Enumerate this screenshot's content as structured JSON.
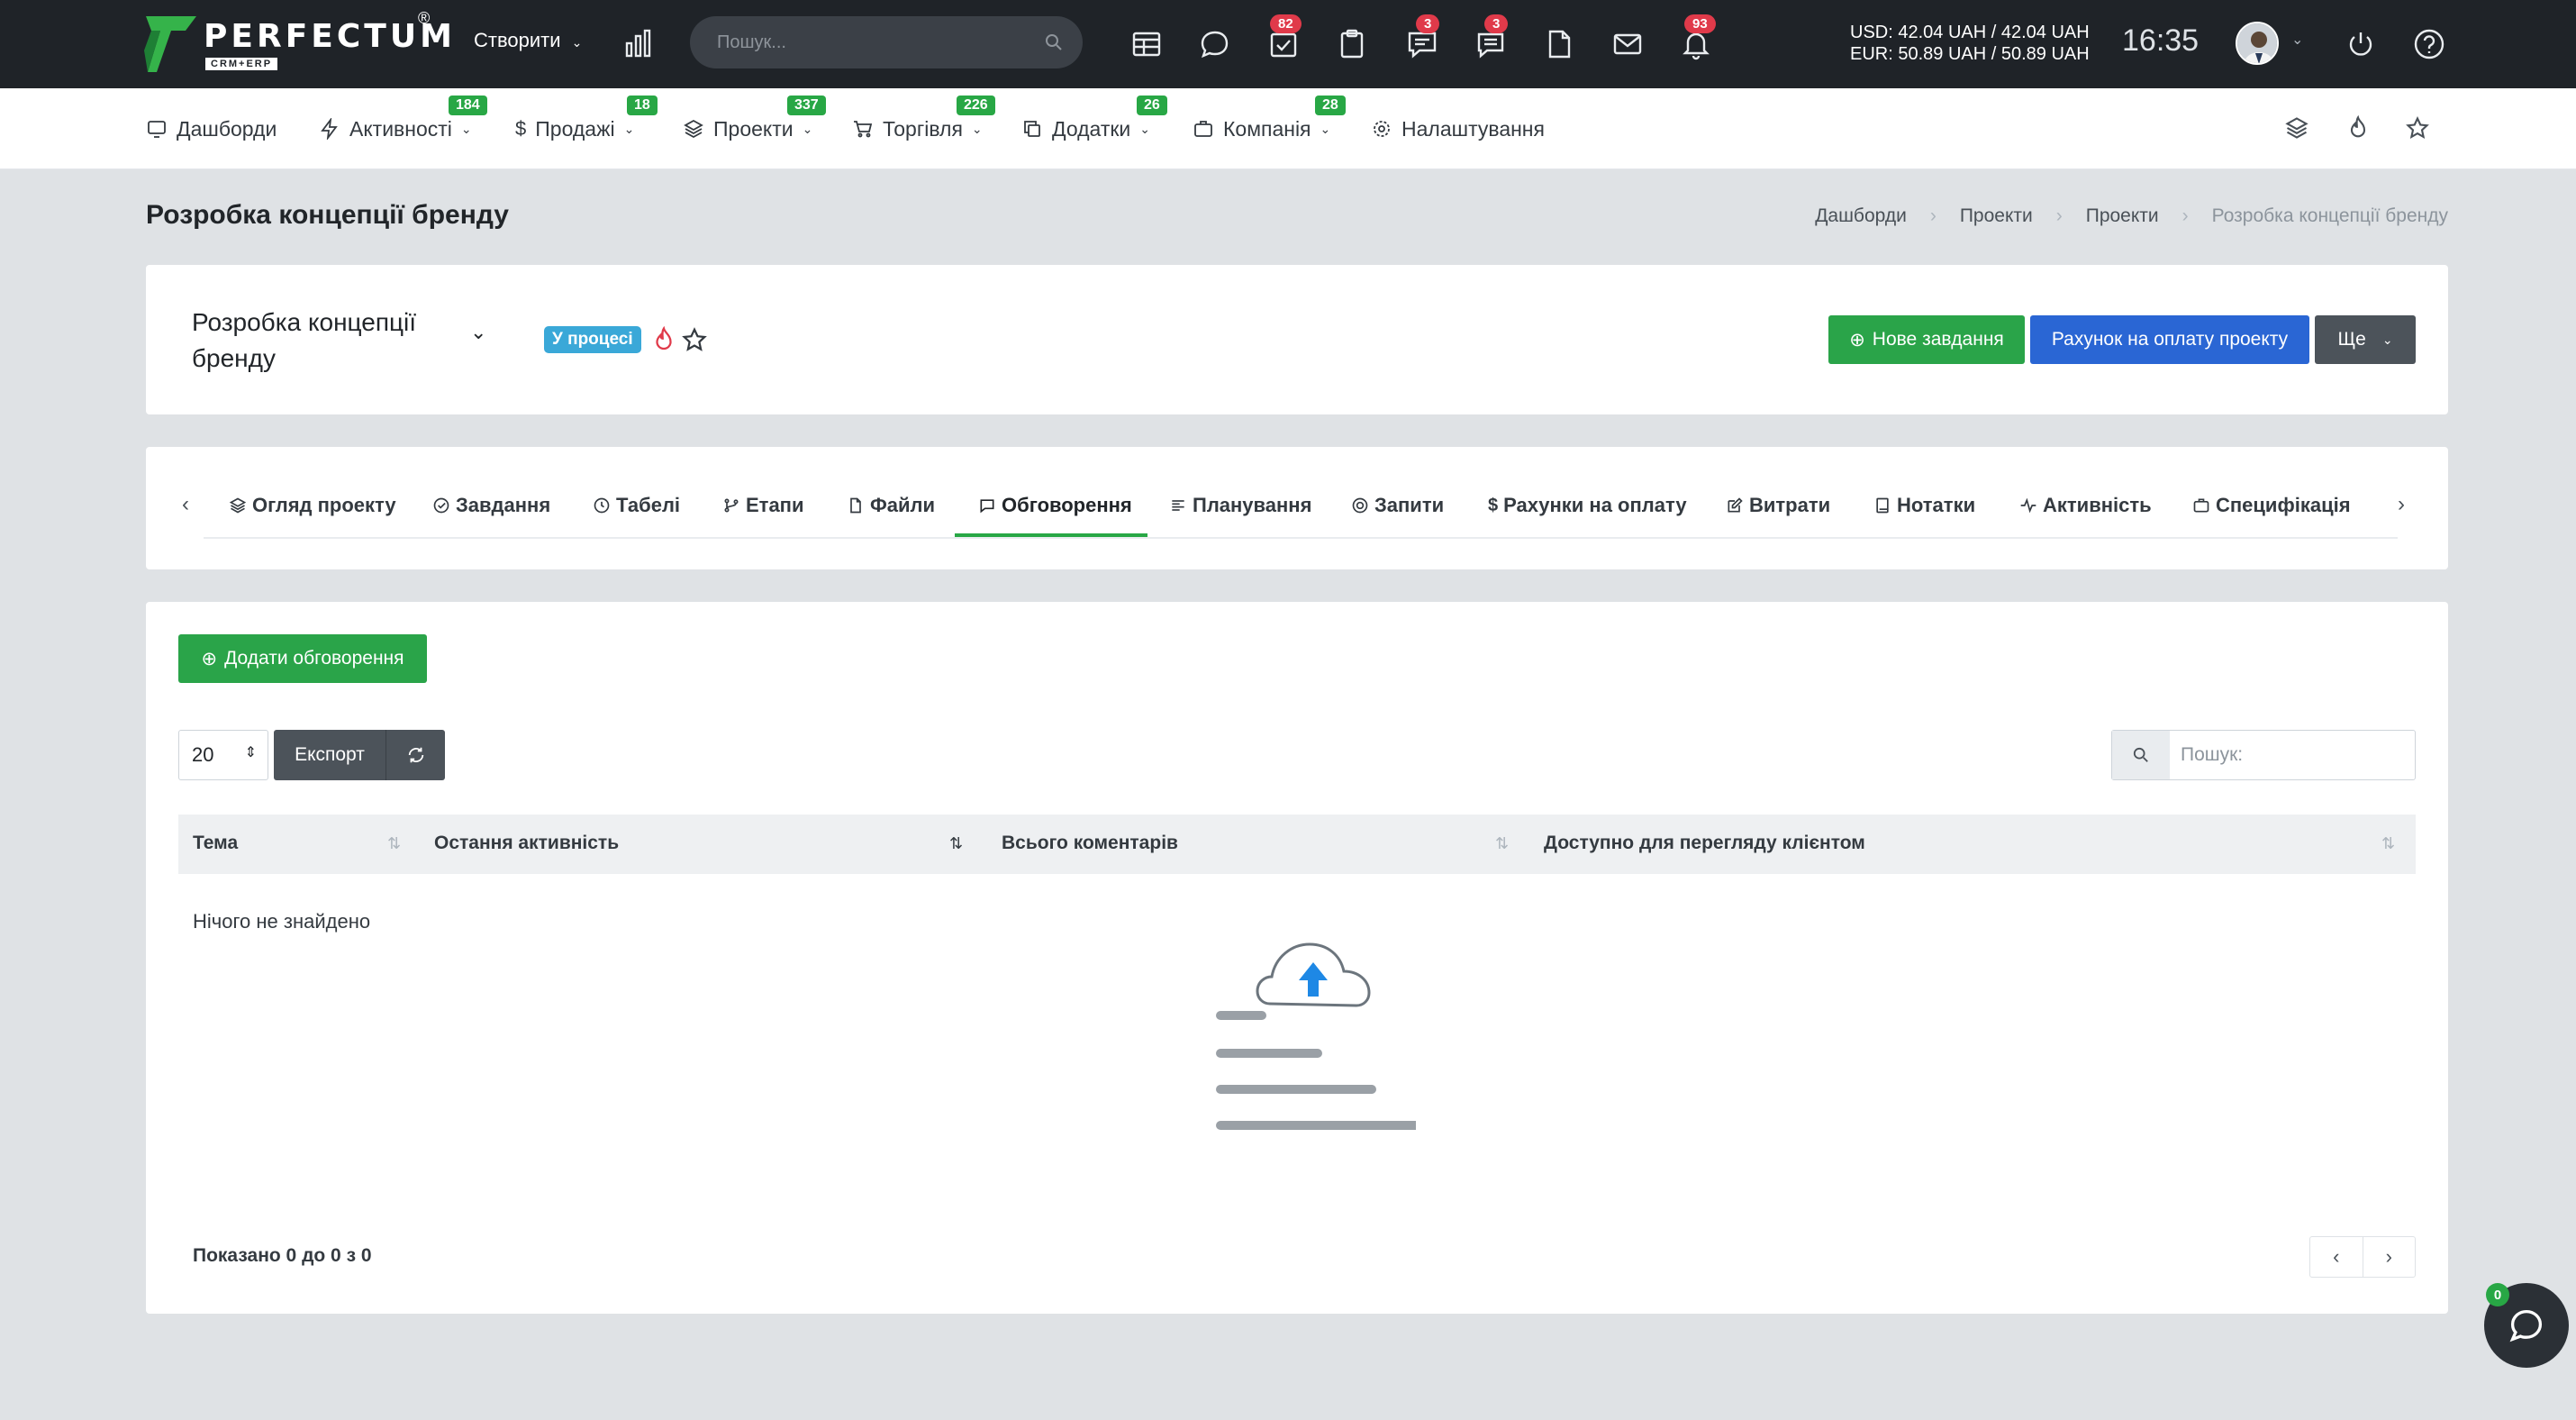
{
  "brand": {
    "name": "PERFECTUM",
    "reg": "®",
    "sub": "CRM+ERP"
  },
  "topbar": {
    "create_label": "Створити",
    "search_placeholder": "Пошук...",
    "badges": {
      "tasks": "82",
      "chats": "3",
      "messages": "3",
      "notifications": "93"
    },
    "rates": {
      "usd": "USD: 42.04 UAH / 42.04 UAH",
      "eur": "EUR: 50.89 UAH / 50.89 UAH"
    },
    "time": "16:35"
  },
  "menu": {
    "dashboards": "Дашборди",
    "activities": "Активності",
    "activities_badge": "184",
    "sales": "Продажі",
    "sales_badge": "18",
    "projects": "Проекти",
    "projects_badge": "337",
    "trade": "Торгівля",
    "trade_badge": "226",
    "addons": "Додатки",
    "addons_badge": "26",
    "company": "Компанія",
    "company_badge": "28",
    "settings": "Налаштування"
  },
  "page": {
    "title": "Розробка концепції бренду",
    "breadcrumb": [
      "Дашборди",
      "Проекти",
      "Проекти",
      "Розробка концепції бренду"
    ]
  },
  "project": {
    "title": "Розробка концепції бренду",
    "status": "У процесі",
    "new_task": "Нове завдання",
    "invoice": "Рахунок на оплату проекту",
    "more": "Ще"
  },
  "tabs": {
    "overview": "Огляд проекту",
    "tasks": "Завдання",
    "timesheets": "Табелі",
    "milestones": "Етапи",
    "files": "Файли",
    "discussions": "Обговорення",
    "planning": "Планування",
    "tickets": "Запити",
    "invoices": "Рахунки на оплату",
    "expenses": "Витрати",
    "notes": "Нотатки",
    "activity": "Активність",
    "spec": "Специфікація"
  },
  "discussions": {
    "add_button": "Додати обговорення",
    "page_size": "20",
    "export": "Експорт",
    "search_placeholder": "Пошук:",
    "columns": [
      "Тема",
      "Остання активність",
      "Всього коментарів",
      "Доступно для перегляду клієнтом"
    ],
    "empty": "Нічого не знайдено",
    "footer": "Показано 0 до 0 з 0"
  },
  "chat": {
    "badge": "0"
  },
  "colors": {
    "accent": "#2aa449",
    "primary": "#2a66d4",
    "topbar": "#1f2328",
    "badge_red": "#e03a4a",
    "status": "#3aa8d8"
  }
}
